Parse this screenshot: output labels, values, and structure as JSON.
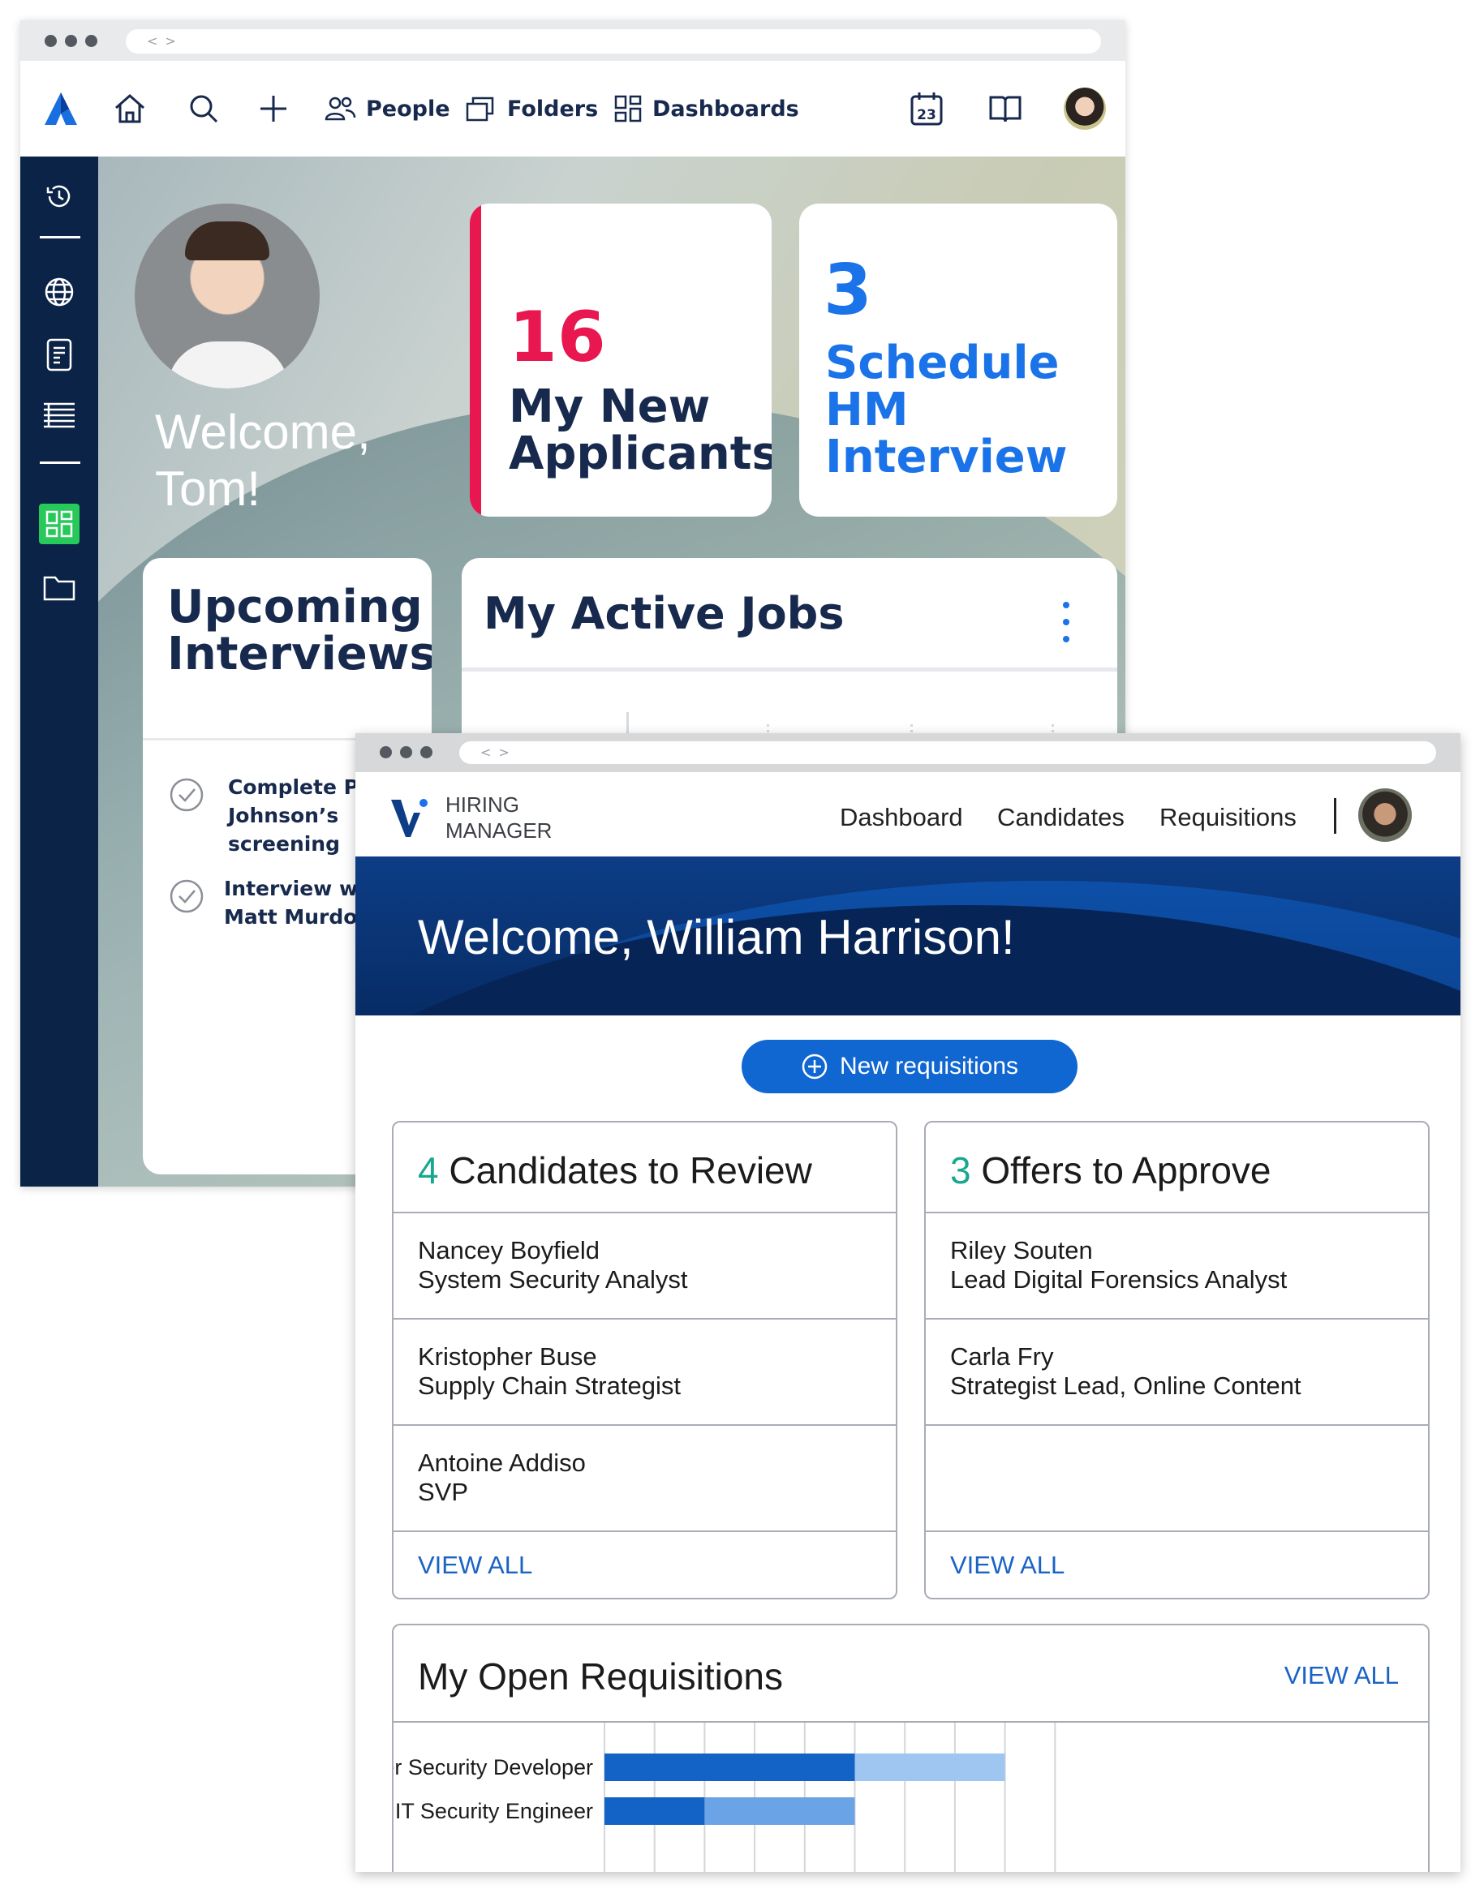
{
  "app1": {
    "address_glyph": "< >",
    "nav": {
      "people": "People",
      "folders": "Folders",
      "dashboards": "Dashboards",
      "calendar_day": "23"
    },
    "welcome": "Welcome, Tom!",
    "welcome_line1": "Welcome,",
    "welcome_line2": "Tom!",
    "applicants_card": {
      "count": "16",
      "line1": "My New",
      "line2": "Applicants",
      "color": "#e8174f"
    },
    "schedule_card": {
      "count": "3",
      "line1": "Schedule",
      "line2": "HM",
      "line3": "Interview",
      "color": "#1a73e8"
    },
    "upcoming": {
      "line1": "Upcoming",
      "line2": "Interviews",
      "tasks": [
        {
          "l1": "Complete Paul",
          "l2": "Johnson’s",
          "l3": "screening"
        },
        {
          "l1": "Interview with",
          "l2": "Matt Murdock"
        }
      ]
    },
    "active_jobs": {
      "title": "My Active Jobs"
    }
  },
  "app2": {
    "address_glyph": "< >",
    "brand_line1": "HIRING",
    "brand_line2": "MANAGER",
    "nav": [
      "Dashboard",
      "Candidates",
      "Requisitions"
    ],
    "welcome": "Welcome, William Harrison!",
    "new_requisitions": "New requisitions",
    "review": {
      "count": "4",
      "title": "Candidates to Review",
      "rows": [
        {
          "name": "Nancey Boyfield",
          "role": "System Security Analyst"
        },
        {
          "name": "Kristopher Buse",
          "role": "Supply Chain Strategist"
        },
        {
          "name": "Antoine Addiso",
          "role": "SVP"
        }
      ],
      "view_all": "VIEW ALL"
    },
    "offers": {
      "count": "3",
      "title": "Offers to Approve",
      "rows": [
        {
          "name": "Riley Souten",
          "role": "Lead Digital Forensics Analyst"
        },
        {
          "name": "Carla Fry",
          "role": "Strategist Lead, Online Content"
        }
      ],
      "view_all": "VIEW ALL"
    },
    "requisitions": {
      "title": "My Open Requisitions",
      "view_all": "VIEW ALL"
    }
  },
  "chart_data": {
    "type": "bar",
    "orientation": "horizontal",
    "stacked": true,
    "categories": [
      "Ciber Security Developer",
      "IT Security Engineer"
    ],
    "series": [
      {
        "values": [
          5,
          2
        ],
        "color": "#1363c6"
      },
      {
        "values": [
          3,
          3
        ],
        "color_by_category": [
          "#9fc6f0",
          "#6aa3e6"
        ]
      }
    ],
    "xlim": [
      0,
      9
    ],
    "grid": true
  }
}
